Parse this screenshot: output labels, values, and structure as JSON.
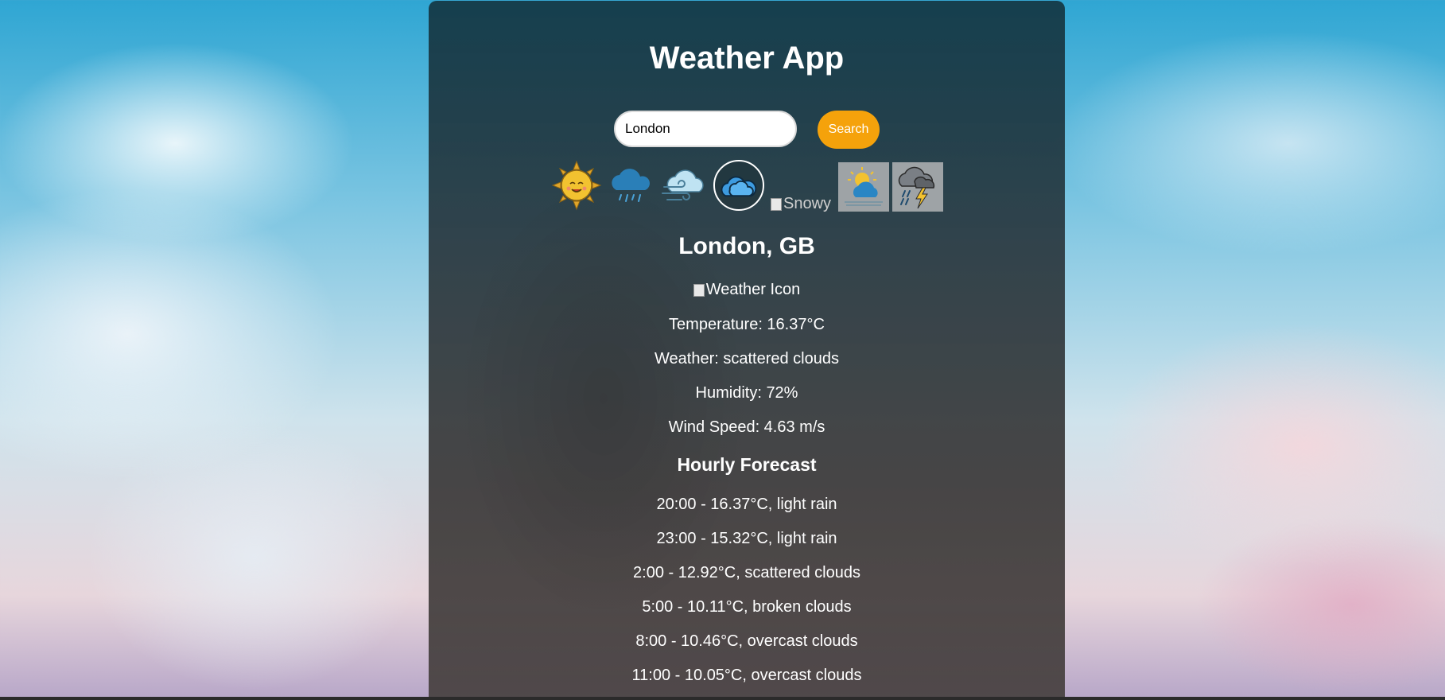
{
  "app": {
    "title": "Weather App"
  },
  "search": {
    "value": "London",
    "button_label": "Search"
  },
  "condition_icons": [
    {
      "name": "sunny",
      "selected": false
    },
    {
      "name": "rainy",
      "selected": false
    },
    {
      "name": "windy",
      "selected": false
    },
    {
      "name": "cloudy",
      "selected": true
    },
    {
      "name": "snowy",
      "alt": "Snowy",
      "broken": true
    },
    {
      "name": "partly-cloudy",
      "selected": false
    },
    {
      "name": "thunderstorm",
      "selected": false
    }
  ],
  "current": {
    "location": "London, GB",
    "icon_alt": "Weather Icon",
    "temperature": "Temperature: 16.37°C",
    "weather": "Weather: scattered clouds",
    "humidity": "Humidity: 72%",
    "wind": "Wind Speed: 4.63 m/s"
  },
  "hourly": {
    "title": "Hourly Forecast",
    "items": [
      "20:00 - 16.37°C, light rain",
      "23:00 - 15.32°C, light rain",
      "2:00 - 12.92°C, scattered clouds",
      "5:00 - 10.11°C, broken clouds",
      "8:00 - 10.46°C, overcast clouds",
      "11:00 - 10.05°C, overcast clouds"
    ]
  },
  "colors": {
    "accent": "#f5a20b",
    "panel": "#2c3a40",
    "text": "#ffffff"
  }
}
